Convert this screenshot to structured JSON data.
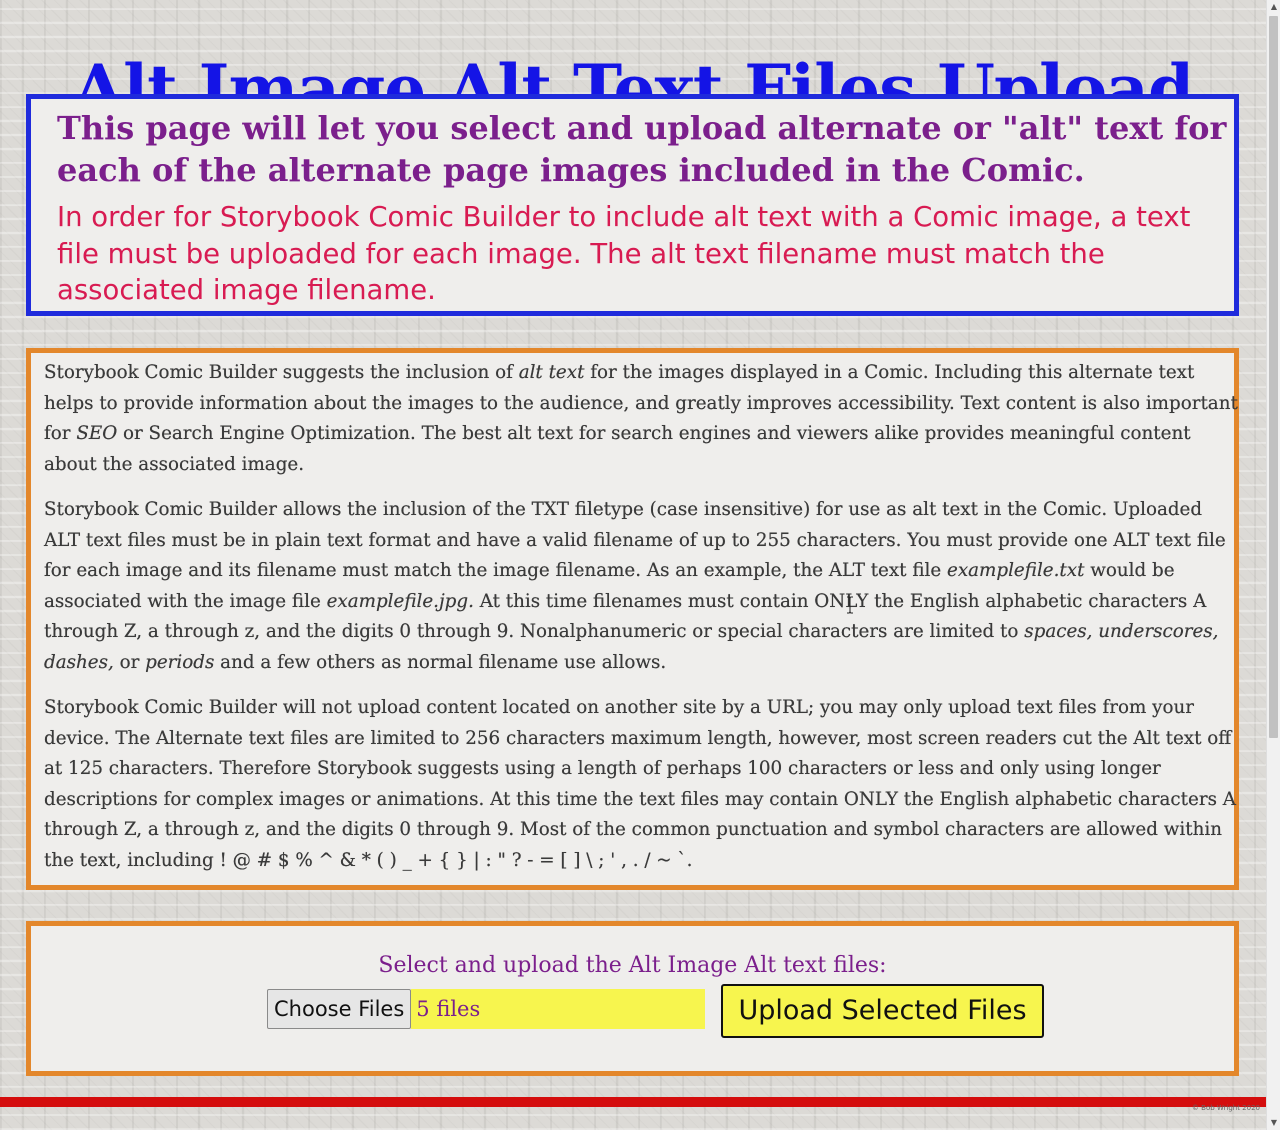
{
  "page": {
    "title": "Alt Image Alt Text Files Upload"
  },
  "intro": {
    "heading": "This page will let you select and upload alternate or \"alt\" text for each of the alternate page images included in the Comic.",
    "note": "In order for Storybook Comic Builder to include alt text with a Comic image, a text file must be uploaded for each image. The alt text filename must match the associated image filename."
  },
  "info": {
    "p1_a": "Storybook Comic Builder suggests the inclusion of ",
    "p1_em1": "alt text",
    "p1_b": " for the images displayed in a Comic. Including this alternate text helps to provide information about the images to the audience, and greatly improves accessibility. Text content is also important for ",
    "p1_em2": "SEO",
    "p1_c": " or Search Engine Optimization. The best alt text for search engines and viewers alike provides meaningful content about the associated image.",
    "p2_a": "Storybook Comic Builder allows the inclusion of the TXT filetype (case insensitive) for use as alt text in the Comic. Uploaded ALT text files must be in plain text format and have a valid filename of up to 255 characters. You must provide one ALT text file for each image and its filename must match the image filename. As an example, the ALT text file ",
    "p2_em1": "examplefile.txt",
    "p2_b": " would be associated with the image file ",
    "p2_em2": "examplefile.jpg.",
    "p2_c": " At this time filenames must contain ONLY the English alphabetic characters A through Z, a through z, and the digits 0 through 9. Nonalphanumeric or special characters are limited to ",
    "p2_em3": "spaces, underscores, dashes,",
    "p2_d": " or ",
    "p2_em4": "periods",
    "p2_e": " and a few others as normal filename use allows.",
    "p3": "Storybook Comic Builder will not upload content located on another site by a URL; you may only upload text files from your device. The Alternate text files are limited to 256 characters maximum length, however, most screen readers cut the Alt text off at 125 characters. Therefore Storybook suggests using a length of perhaps 100 characters or less and only using longer descriptions for complex images or animations. At this time the text files may contain ONLY the English alphabetic characters A through Z, a through z, and the digits 0 through 9. Most of the common punctuation and symbol characters are allowed within the text, including ! @ # $ % ^ & * ( ) _ + { } | : \" ? - = [ ] \\ ; ' , . / ~ `."
  },
  "upload": {
    "label": "Select and upload the Alt Image Alt text files:",
    "choose_button": "Choose Files",
    "file_status": "5 files",
    "upload_button": "Upload Selected Files"
  },
  "footer": {
    "copyright": "© Bob Wright 2020"
  },
  "colors": {
    "title": "#1414e6",
    "intro_border": "#1f2bdc",
    "intro_heading": "#7b1f8c",
    "intro_note": "#d81b52",
    "info_border": "#e3872b",
    "highlight": "#f7f54e",
    "rule": "#d40d0d"
  }
}
